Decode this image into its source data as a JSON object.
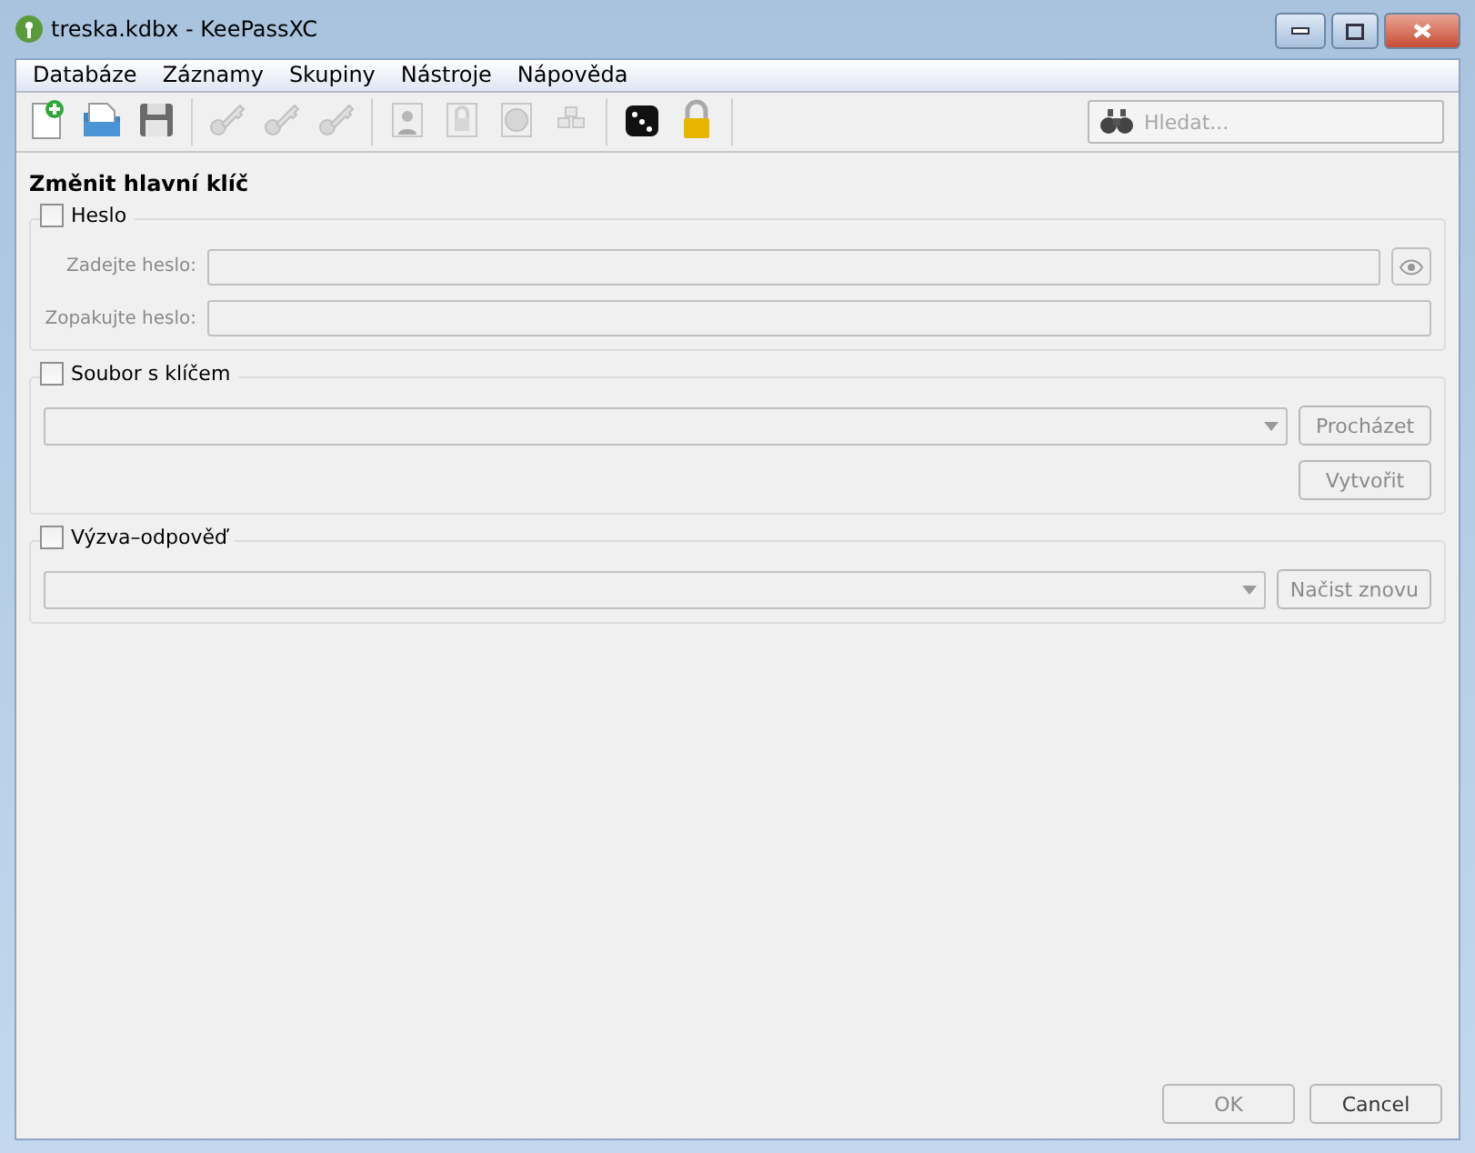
{
  "window": {
    "title": "treska.kdbx - KeePassXC"
  },
  "menu": [
    "Databáze",
    "Záznamy",
    "Skupiny",
    "Nástroje",
    "Nápověda"
  ],
  "toolbar": [
    {
      "kind": "new",
      "disabled": false
    },
    {
      "kind": "open",
      "disabled": false
    },
    {
      "kind": "save",
      "disabled": false
    },
    {
      "kind": "sep"
    },
    {
      "kind": "add",
      "disabled": true
    },
    {
      "kind": "edit",
      "disabled": true
    },
    {
      "kind": "delete",
      "disabled": true
    },
    {
      "kind": "sep"
    },
    {
      "kind": "user",
      "disabled": true
    },
    {
      "kind": "lockdoc",
      "disabled": true
    },
    {
      "kind": "globe",
      "disabled": true
    },
    {
      "kind": "keyboard",
      "disabled": true
    },
    {
      "kind": "sep"
    },
    {
      "kind": "dice",
      "disabled": false
    },
    {
      "kind": "lock",
      "disabled": false
    },
    {
      "kind": "sep"
    }
  ],
  "search": {
    "placeholder": "Hledat..."
  },
  "heading": "Změnit hlavní klíč",
  "groups": [
    {
      "kind": "password",
      "label": "Heslo",
      "checked": false,
      "fields": [
        {
          "label": "Zadejte heslo:",
          "disabled": true
        },
        {
          "label": "Zopakujte heslo:",
          "disabled": true
        }
      ]
    },
    {
      "kind": "keyfile",
      "label": "Soubor s klíčem",
      "checked": false,
      "buttons": [
        {
          "label": "Procházet",
          "disabled": true
        },
        {
          "label": "Vytvořit",
          "disabled": true
        }
      ]
    },
    {
      "kind": "challenge",
      "label": "Výzva–odpověď",
      "checked": false,
      "buttons": [
        {
          "label": "Načist znovu",
          "disabled": true
        }
      ]
    }
  ],
  "buttons": [
    {
      "label": "OK",
      "disabled": true
    },
    {
      "label": "Cancel",
      "disabled": false
    }
  ]
}
